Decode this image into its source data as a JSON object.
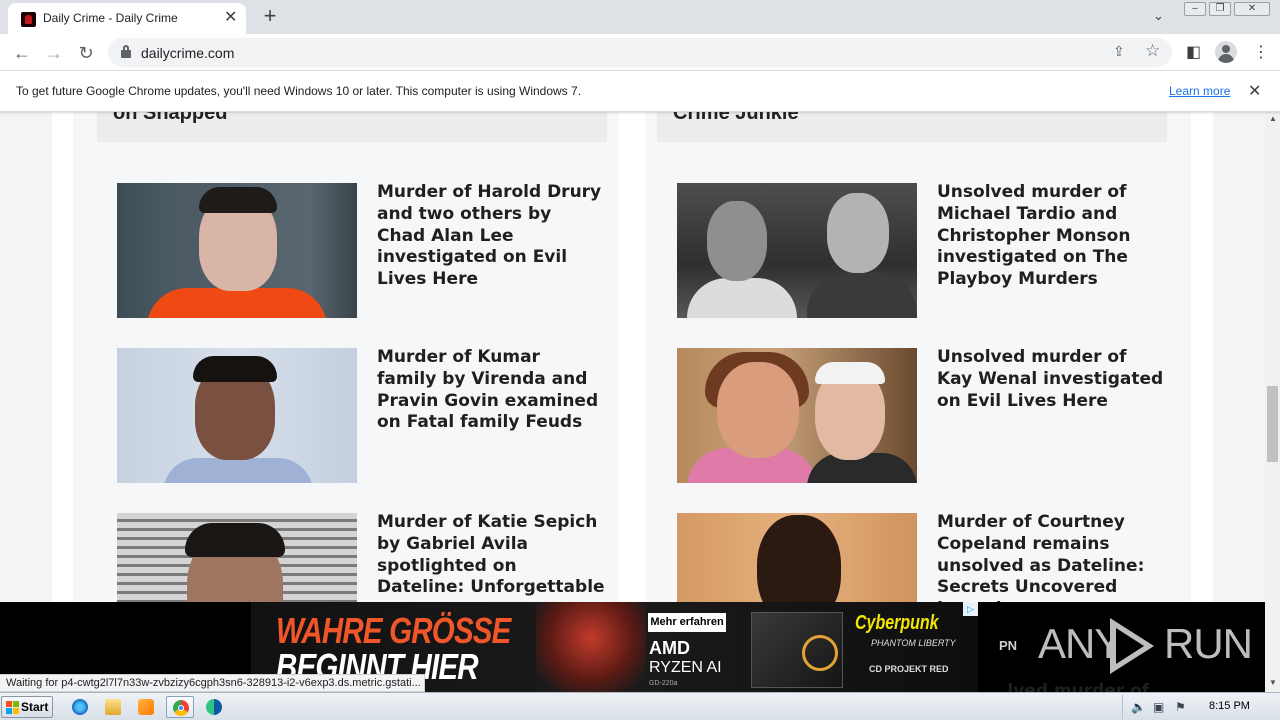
{
  "browser": {
    "tab_title": "Daily Crime - Daily Crime",
    "tab_close": "✕",
    "new_tab": "+",
    "url": "dailycrime.com",
    "icons": [
      "back-icon",
      "forward-icon",
      "reload-icon",
      "lock-icon",
      "share-icon",
      "star-icon",
      "side-panel-icon",
      "profile-icon",
      "kebab-menu-icon"
    ]
  },
  "infobar": {
    "message": "To get future Google Chrome updates, you'll need Windows 10 or later. This computer is using Windows 7.",
    "link": "Learn more",
    "close": "✕"
  },
  "columns": [
    {
      "heading": "on Snapped",
      "cards": [
        {
          "title": "Murder of Harold Drury and two others by Chad Alan Lee investigated on Evil Lives Here"
        },
        {
          "title": "Murder of Kumar family by Virenda and Pravin Govin examined on Fatal family Feuds"
        },
        {
          "title": "Murder of Katie Sepich by Gabriel Avila spotlighted on Dateline: Unforgettable"
        }
      ]
    },
    {
      "heading": "Crime Junkie",
      "cards": [
        {
          "title": "Unsolved murder of Michael Tardio and Christopher Monson investigated on The Playboy Murders"
        },
        {
          "title": "Unsolved murder of Kay Wenal investigated on Evil Lives Here"
        },
        {
          "title": "Murder of Courtney Copeland remains unsolved as Dateline: Secrets Uncovered investigates"
        }
      ],
      "next_card_peek": "...lved murder of"
    }
  ],
  "ad": {
    "headline_1": "WAHRE GRÖSSE",
    "headline_2": "BEGINNT HIER",
    "cta": "Mehr erfahren",
    "brand": "AMD",
    "product": "RYZEN AI",
    "model": "GD-220a",
    "game": "Cyberpunk",
    "game_sub": "PHANTOM LIBERTY",
    "studio": "CD PROJEKT RED",
    "adchoices": "▷",
    "brand_accent": "#f0562a"
  },
  "overlay": {
    "pn": "PN",
    "watermark_left": "ANY",
    "watermark_right": "RUN"
  },
  "status_text": "Waiting for p4-cwtg2l7l7n33w-zvbzizy6cgph3sn6-328913-i2-v6exp3.ds.metric.gstati...",
  "taskbar": {
    "start": "Start",
    "time": "8:15 PM",
    "apps": [
      "ie-icon",
      "explorer-icon",
      "media-player-icon",
      "chrome-icon",
      "edge-icon"
    ]
  }
}
